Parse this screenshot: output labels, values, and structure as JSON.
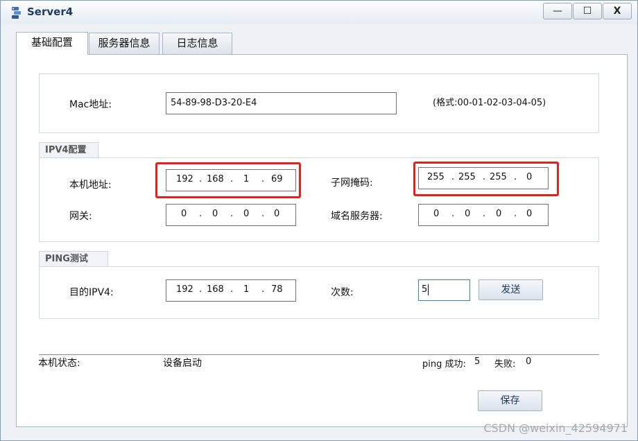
{
  "window": {
    "title": "Server4",
    "minimize_label": "—",
    "maximize_label": "☐",
    "close_label": "X"
  },
  "tabs": [
    {
      "label": "基础配置",
      "active": true
    },
    {
      "label": "服务器信息",
      "active": false
    },
    {
      "label": "日志信息",
      "active": false
    }
  ],
  "mac": {
    "label": "Mac地址:",
    "value": "54-89-98-D3-20-E4",
    "hint": "(格式:00-01-02-03-04-05)"
  },
  "ipv4": {
    "legend": "IPV4配置",
    "local_label": "本机地址:",
    "local": [
      "192",
      "168",
      "1",
      "69"
    ],
    "mask_label": "子网掩码:",
    "mask": [
      "255",
      "255",
      "255",
      "0"
    ],
    "gateway_label": "网关:",
    "gateway": [
      "0",
      "0",
      "0",
      "0"
    ],
    "dns_label": "域名服务器:",
    "dns": [
      "0",
      "0",
      "0",
      "0"
    ]
  },
  "ping": {
    "legend": "PING测试",
    "dest_label": "目的IPV4:",
    "dest": [
      "192",
      "168",
      "1",
      "78"
    ],
    "count_label": "次数:",
    "count": "5",
    "send_label": "发送"
  },
  "status": {
    "label": "本机状态:",
    "value": "设备启动",
    "ping_success_label": "ping 成功:",
    "ping_success": "5",
    "fail_label": "失败:",
    "fail": "0"
  },
  "save_label": "保存",
  "watermark": "CSDN @weixin_42594971",
  "colors": {
    "highlight": "#e0211d",
    "accent": "#1f3a66"
  }
}
